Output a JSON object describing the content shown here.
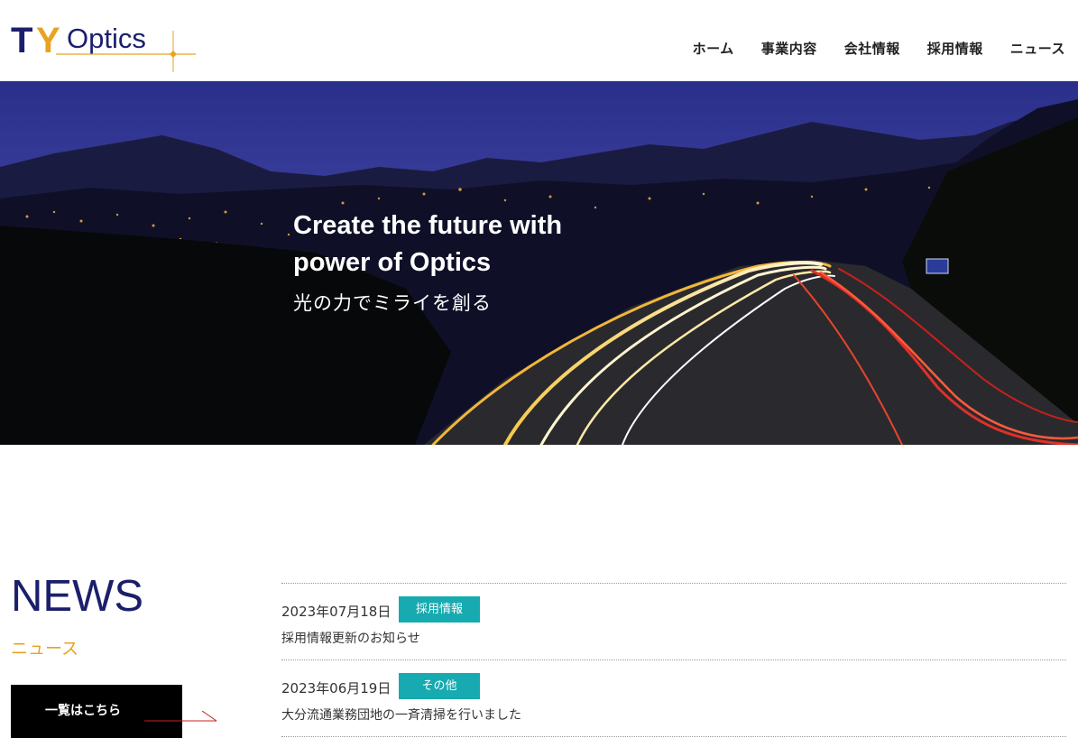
{
  "header": {
    "logo_text_ty": "TY",
    "logo_text_optics": "Optics",
    "nav": [
      {
        "label": "ホーム"
      },
      {
        "label": "事業内容"
      },
      {
        "label": "会社情報"
      },
      {
        "label": "採用情報"
      },
      {
        "label": "ニュース"
      }
    ]
  },
  "hero": {
    "line1": "Create the future with",
    "line2": "power of Optics",
    "jp": "光の力でミライを創る"
  },
  "news": {
    "title": "NEWS",
    "subtitle": "ニュース",
    "button_label": "一覧はこちら",
    "items": [
      {
        "date": "2023年07月18日",
        "tag": "採用情報",
        "text": "採用情報更新のお知らせ"
      },
      {
        "date": "2023年06月19日",
        "tag": "その他",
        "text": "大分流通業務団地の一斉清掃を行いました"
      }
    ]
  },
  "colors": {
    "brand_navy": "#1b1f6b",
    "brand_orange": "#e8a320",
    "tag_teal": "#17aab0"
  },
  "icons": [
    "logo-sparkle-icon",
    "arrow-line-icon"
  ]
}
